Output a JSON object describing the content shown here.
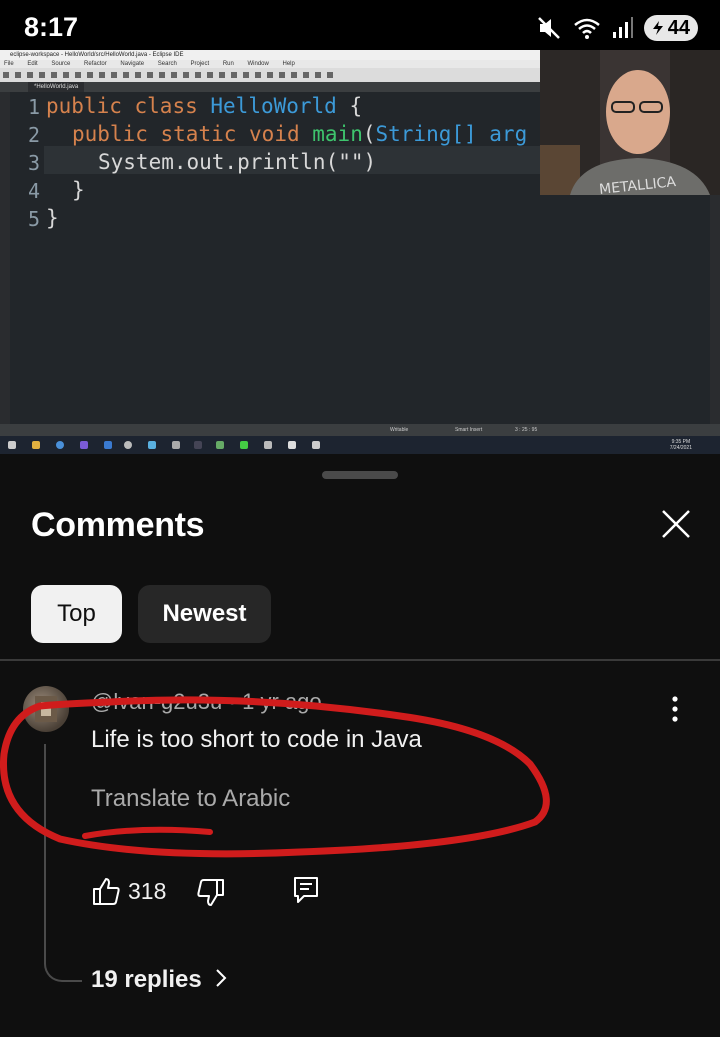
{
  "status_bar": {
    "time": "8:17",
    "battery": "44",
    "icons": [
      "mute-icon",
      "wifi-icon",
      "signal-icon",
      "battery-icon"
    ]
  },
  "video": {
    "ide_title": "eclipse-workspace - HelloWorld/src/HelloWorld.java - Eclipse IDE",
    "menu": [
      "File",
      "Edit",
      "Source",
      "Refactor",
      "Navigate",
      "Search",
      "Project",
      "Run",
      "Window",
      "Help"
    ],
    "editor_tab": "*HelloWorld.java",
    "line_numbers": [
      "1",
      "2",
      "3",
      "4",
      "5"
    ],
    "code": {
      "line1": {
        "kw1": "public",
        "kw2": "class",
        "name": "HelloWorld",
        "rest": " {"
      },
      "line2": {
        "kw1": "public",
        "kw2": "static",
        "kw3": "void",
        "fn": "main",
        "p1": "(",
        "type": "String",
        "rest": "[] arg"
      },
      "line3": "System.out.println(\"\")",
      "line4": "}",
      "line5": "}"
    },
    "status": {
      "writable": "Writable",
      "insert": "Smart Insert",
      "position": "3 : 25 : 95"
    },
    "taskbar_clock": {
      "time": "9:35 PM",
      "date": "7/24/2021"
    }
  },
  "comments": {
    "title": "Comments",
    "sort_chips": [
      {
        "label": "Top",
        "selected": true
      },
      {
        "label": "Newest",
        "selected": false
      }
    ],
    "items": [
      {
        "author": "@lvan-g2u3u",
        "separator": "•",
        "age": "1 yr ago",
        "text": "Life is too short to code in Java",
        "translate": "Translate to Arabic",
        "likes": "318",
        "replies": "19 replies"
      }
    ],
    "annotation_color": "#d01c1c"
  }
}
